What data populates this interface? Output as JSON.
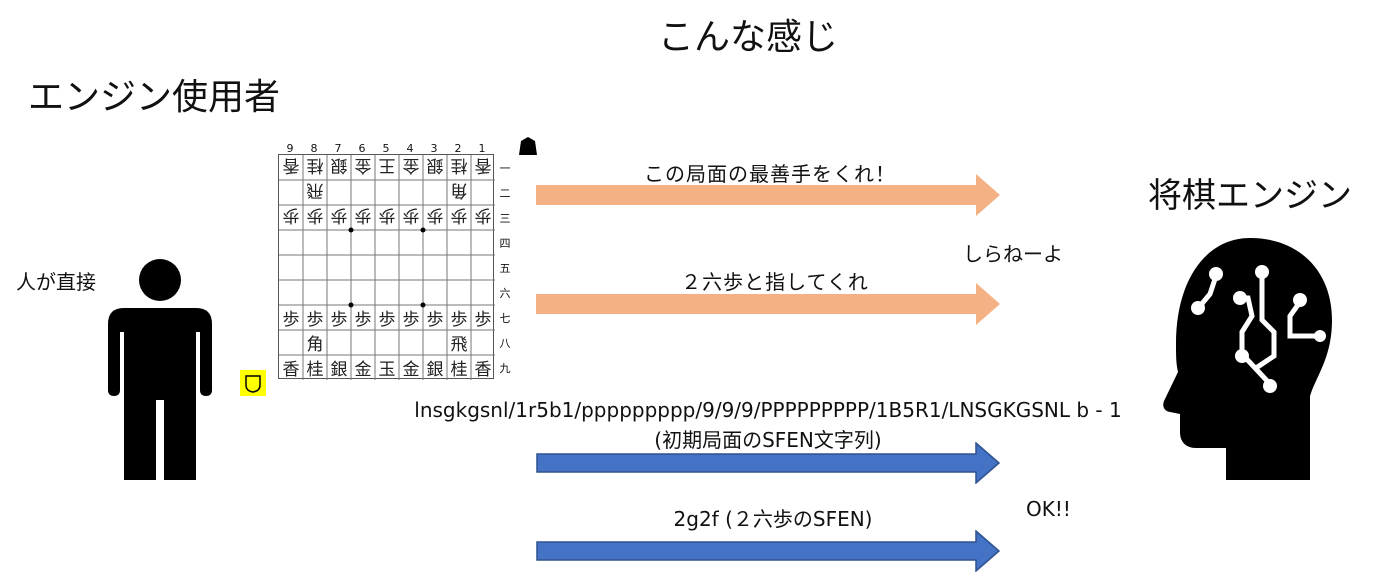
{
  "title": "こんな感じ",
  "user_label": "エンジン使用者",
  "engine_label": "将棋エンジン",
  "direct_label": "人が直接",
  "messages": {
    "best_move": "この局面の最善手をくれ！",
    "move_request": "２六歩と指してくれ",
    "sfen_position": "lnsgkgsnl/1r5b1/ppppppppp/9/9/9/PPPPPPPPP/1B5R1/LNSGKGSNL b - 1",
    "sfen_note": "(初期局面のSFEN文字列)",
    "sfen_move": "2g2f (２六歩のSFEN)"
  },
  "replies": {
    "unknown": "しらねーよ",
    "ok": "OK!!"
  },
  "board": {
    "files": [
      "9",
      "8",
      "7",
      "6",
      "5",
      "4",
      "3",
      "2",
      "1"
    ],
    "ranks": [
      "一",
      "二",
      "三",
      "四",
      "五",
      "六",
      "七",
      "八",
      "九"
    ],
    "rows": [
      [
        "香",
        "桂",
        "銀",
        "金",
        "王",
        "金",
        "銀",
        "桂",
        "香"
      ],
      [
        "",
        "飛",
        "",
        "",
        "",
        "",
        "",
        "角",
        ""
      ],
      [
        "歩",
        "歩",
        "歩",
        "歩",
        "歩",
        "歩",
        "歩",
        "歩",
        "歩"
      ],
      [
        "",
        "",
        "",
        "",
        "",
        "",
        "",
        "",
        ""
      ],
      [
        "",
        "",
        "",
        "",
        "",
        "",
        "",
        "",
        ""
      ],
      [
        "",
        "",
        "",
        "",
        "",
        "",
        "",
        "",
        ""
      ],
      [
        "歩",
        "歩",
        "歩",
        "歩",
        "歩",
        "歩",
        "歩",
        "歩",
        "歩"
      ],
      [
        "",
        "角",
        "",
        "",
        "",
        "",
        "",
        "飛",
        ""
      ],
      [
        "香",
        "桂",
        "銀",
        "金",
        "玉",
        "金",
        "銀",
        "桂",
        "香"
      ]
    ]
  },
  "colors": {
    "orange_arrow": "#f4b183",
    "blue_arrow": "#4472c4",
    "hand_marker": "#ffff00"
  }
}
